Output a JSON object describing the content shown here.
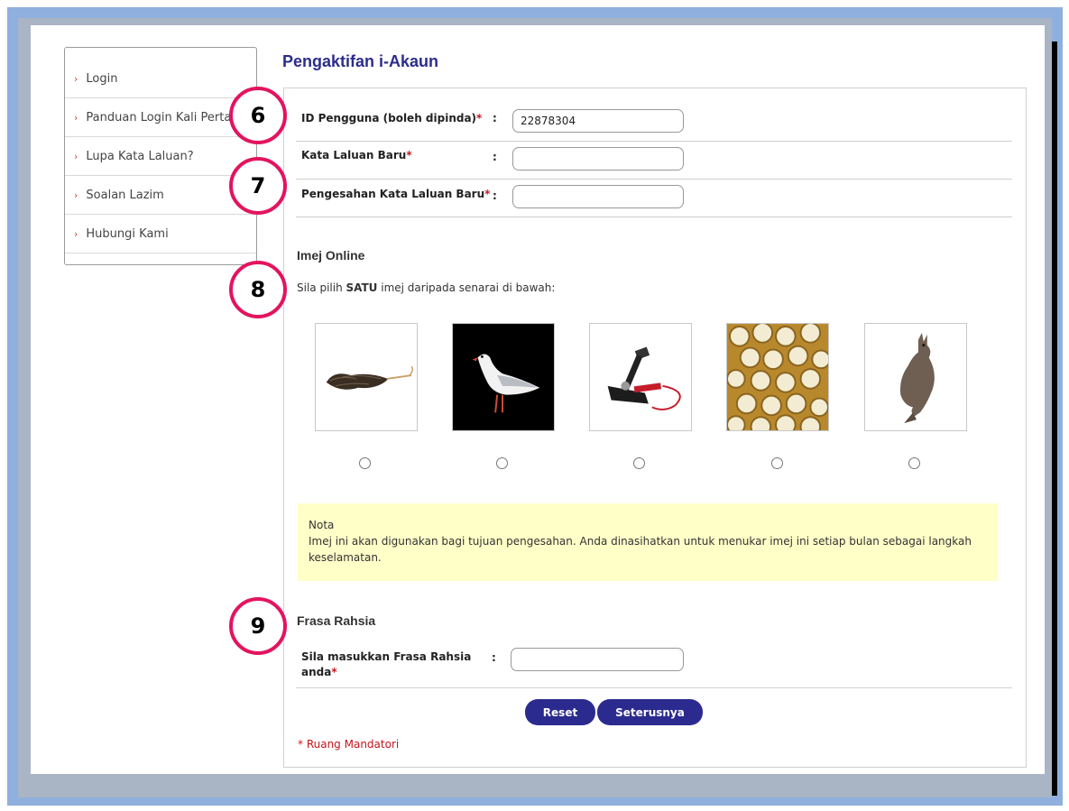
{
  "sidebar": {
    "items": [
      {
        "label": "Login"
      },
      {
        "label": "Panduan Login Kali Pertama"
      },
      {
        "label": "Lupa Kata Laluan?"
      },
      {
        "label": "Soalan Lazim"
      },
      {
        "label": "Hubungi Kami"
      }
    ]
  },
  "page_title": "Pengaktifan i-Akaun",
  "form": {
    "user_id": {
      "label": "ID Pengguna (boleh dipinda)",
      "value": "22878304"
    },
    "new_password": {
      "label": "Kata Laluan Baru",
      "value": ""
    },
    "confirm_password": {
      "label": "Pengesahan Kata Laluan Baru",
      "value": ""
    },
    "required_mark": "*",
    "colon": ":"
  },
  "image_section": {
    "heading": "Imej Online",
    "instruction_pre": "Sila pilih ",
    "instruction_bold": "SATU",
    "instruction_post": " imej daripada senarai di bawah:",
    "images": [
      {
        "icon": "feather-duster-icon"
      },
      {
        "icon": "seagull-icon"
      },
      {
        "icon": "foot-pump-icon"
      },
      {
        "icon": "rice-cakes-icon"
      },
      {
        "icon": "kangaroo-icon"
      }
    ]
  },
  "note": {
    "title": "Nota",
    "text": "Imej ini akan digunakan bagi tujuan pengesahan. Anda dinasihatkan untuk menukar imej ini setiap bulan sebagai langkah keselamatan."
  },
  "phrase_section": {
    "heading": "Frasa Rahsia",
    "label": "Sila masukkan Frasa Rahsia anda",
    "value": ""
  },
  "buttons": {
    "reset": "Reset",
    "next": "Seterusnya"
  },
  "mandatory_note": "* Ruang Mandatori",
  "callouts": [
    "6",
    "7",
    "8",
    "9"
  ],
  "colors": {
    "accent": "#2b2b8f",
    "title": "#2c2c8c",
    "required": "#c4161c",
    "callout_ring": "#e3145f",
    "note_bg": "#ffffc8"
  }
}
